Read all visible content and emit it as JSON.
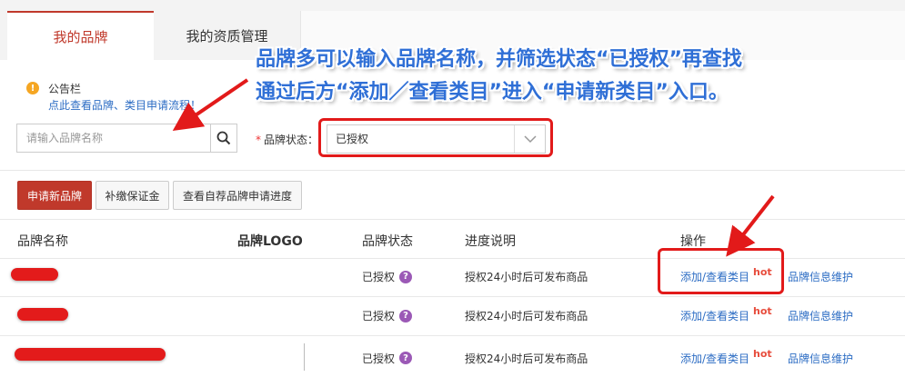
{
  "tabs": {
    "active": "我的品牌",
    "inactive": "我的资质管理"
  },
  "notice": {
    "title": "公告栏",
    "link": "点此查看品牌、类目申请流程！",
    "icon": "warning-icon"
  },
  "search": {
    "placeholder": "请输入品牌名称",
    "icon": "search-icon"
  },
  "filter": {
    "required_mark": "*",
    "label": "品牌状态：",
    "selected": "已授权",
    "icon": "chevron-down-icon"
  },
  "buttons": {
    "apply_new": "申请新品牌",
    "deposit": "补缴保证金",
    "progress": "查看自荐品牌申请进度"
  },
  "table": {
    "headers": [
      "品牌名称",
      "品牌LOGO",
      "品牌状态",
      "进度说明",
      "操作"
    ],
    "rows": [
      {
        "status": "已授权",
        "progress": "授权24小时后可发布商品",
        "action": "添加/查看类目",
        "hot": "hot",
        "maintain": "品牌信息维护"
      },
      {
        "status": "已授权",
        "progress": "授权24小时后可发布商品",
        "action": "添加/查看类目",
        "hot": "hot",
        "maintain": "品牌信息维护"
      },
      {
        "status": "已授权",
        "progress": "授权24小时后可发布商品",
        "action": "添加/查看类目",
        "hot": "hot",
        "maintain": "品牌信息维护"
      }
    ]
  },
  "annotation": {
    "line1": "品牌多可以输入品牌名称，并筛选状态“已授权”再查找",
    "line2": "通过后方“添加／查看类目”进入“申请新类目”入口。"
  },
  "colors": {
    "brand": "#c0392b",
    "link": "#2d6dc4",
    "annotation_text": "#2f6fd6",
    "highlight": "#e21a1a"
  }
}
